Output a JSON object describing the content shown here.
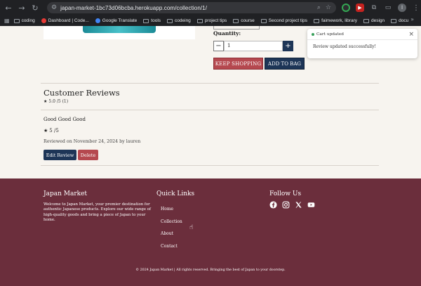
{
  "browser": {
    "url": "japan-market-1bc73d06bcba.herokuapp.com/collection/1/",
    "avatar_letter": "l",
    "bookmarks": [
      {
        "label": "coding",
        "type": "folder"
      },
      {
        "label": "Dashboard | Code...",
        "type": "site",
        "color": "#e53935"
      },
      {
        "label": "Google Translate",
        "type": "site",
        "color": "#4285f4"
      },
      {
        "label": "tools",
        "type": "folder"
      },
      {
        "label": "codeing",
        "type": "folder"
      },
      {
        "label": "project tips",
        "type": "folder"
      },
      {
        "label": "course",
        "type": "folder"
      },
      {
        "label": "Second project tips",
        "type": "folder"
      },
      {
        "label": "faimework, library",
        "type": "folder"
      },
      {
        "label": "design",
        "type": "folder"
      },
      {
        "label": "docu",
        "type": "folder"
      }
    ],
    "more": "»"
  },
  "product": {
    "quantity_label": "Quantity:",
    "quantity_value": "1",
    "minus": "−",
    "plus": "+",
    "keep_shopping": "KEEP SHOPPING",
    "add_to_bag": "ADD TO BAG"
  },
  "toast": {
    "title": "Cart updated",
    "message": "Review updated successfully!",
    "close": "×"
  },
  "reviews": {
    "title": "Customer Reviews",
    "summary": "5.0 /5 (1)",
    "items": [
      {
        "title": "Good Good Good",
        "rating": "5 /5",
        "meta": "Reviewed on November 24, 2024 by lauren",
        "edit": "Edit Review",
        "delete": "Delete"
      }
    ]
  },
  "footer": {
    "brand": "Japan Market",
    "about": "Welcome to Japan Market, your premier destination for authentic Japanese products. Explore our wide range of high-quality goods and bring a piece of Japan to your home.",
    "quick_links_title": "Quick Links",
    "links": [
      "Home",
      "Collection",
      "About",
      "Contact"
    ],
    "follow_title": "Follow Us",
    "social": [
      "facebook-icon",
      "instagram-icon",
      "x-icon",
      "youtube-icon"
    ],
    "copyright": "© 2024 Japan Market | All rights reserved. Bringing the best of Japan to your doorstep."
  },
  "colors": {
    "primary": "#1d3557",
    "accent": "#b5484f",
    "footer_bg": "#6b2e3c",
    "page_bg": "#f7f4ef"
  }
}
